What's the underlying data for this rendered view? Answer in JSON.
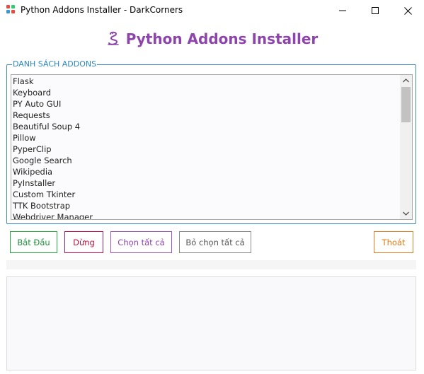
{
  "window": {
    "title": "Python Addons Installer - DarkCorners",
    "icon": "app-grid-icon",
    "controls": [
      "minimize-icon",
      "maximize-icon",
      "close-icon"
    ]
  },
  "header": {
    "icon": "python-snake-icon",
    "title": "Python Addons Installer",
    "color": "#8e44ad"
  },
  "addons_group": {
    "legend": "DANH SÁCH ADDONS",
    "border_color": "#3b8ac4",
    "items": [
      "Flask",
      "Keyboard",
      "PY Auto GUI",
      "Requests",
      "Beautiful Soup 4",
      "Pillow",
      "PyperClip",
      "Google Search",
      "Wikipedia",
      "PyInstaller",
      "Custom Tkinter",
      "TTK Bootstrap",
      "Webdriver Manager"
    ]
  },
  "buttons": {
    "start": "Bắt Đầu",
    "stop": "Dừng",
    "select_all": "Chọn tất cả",
    "deselect_all": "Bỏ chọn tất cả",
    "quit": "Thoát"
  },
  "button_colors": {
    "start": "#2aa842",
    "stop": "#c8104a",
    "select_all": "#9b59b6",
    "deselect_all": "#888888",
    "quit": "#e67e22"
  },
  "progress": {
    "value": 0
  },
  "log": {
    "text": ""
  }
}
